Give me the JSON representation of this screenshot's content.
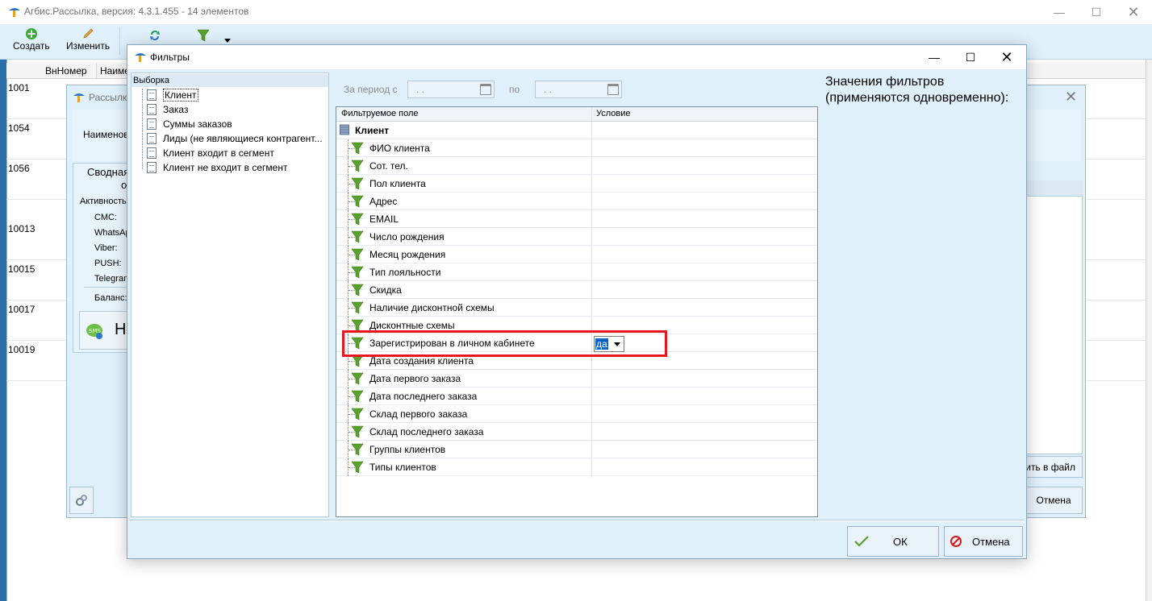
{
  "app": {
    "title": "Агбис.Рассылка, версия: 4.3.1.455 - 14 элементов",
    "toolbar": {
      "create_label": "Создать",
      "edit_label": "Изменить"
    },
    "grid": {
      "columns": [
        "ВнНомер",
        "Наиме"
      ],
      "rows": [
        "1001",
        "1054",
        "1056",
        "10013",
        "10015",
        "10017",
        "10019"
      ]
    }
  },
  "mid_dialog": {
    "title": "Рассылк",
    "name_label": "Наименов",
    "group_title_1": "Сводная",
    "group_title_2": "о",
    "activity_label": "Активность",
    "channels": [
      "СМС:",
      "WhatsAp",
      "Viber:",
      "PUSH:",
      "Telegram"
    ],
    "balance_label": "Баланс:",
    "sms_letter": "Н",
    "save_file_label": "ить в файл",
    "cancel_label": "Отмена"
  },
  "filter_dialog": {
    "title": "Фильтры",
    "tree": {
      "header": "Выборка",
      "items": [
        "Клиент",
        "Заказ",
        "Суммы заказов",
        "Лиды (не являющиеся контрагент...",
        "Клиент входит в сегмент",
        "Клиент не входит в сегмент"
      ]
    },
    "period": {
      "from_label": "За период с",
      "from_value": ". .",
      "to_label": "по",
      "to_value": ". ."
    },
    "grid": {
      "col_field": "Фильтруемое поле",
      "col_condition": "Условие",
      "group": "Клиент",
      "fields": [
        "ФИО клиента",
        "Сот. тел.",
        "Пол клиента",
        "Адрес",
        "EMAIL",
        "Число рождения",
        "Месяц рождения",
        "Тип лояльности",
        "Скидка",
        "Наличие дисконтной схемы",
        "Дисконтные схемы",
        "Зарегистрирован в личном кабинете",
        "Дата создания клиента",
        "Дата первого заказа",
        "Дата последнего заказа",
        "Склад первого заказа",
        "Склад последнего заказа",
        "Группы клиентов",
        "Типы клиентов"
      ],
      "selected_condition": "да"
    },
    "values_title": "Значения фильтров (применяются одновременно):",
    "ok_label": "ОК",
    "cancel_label": "Отмена"
  },
  "colors": {
    "accent": "#0a64c8",
    "highlight": "#e8141e",
    "dialog_bg": "#dff0fa",
    "funnel": "#5aa02c"
  }
}
